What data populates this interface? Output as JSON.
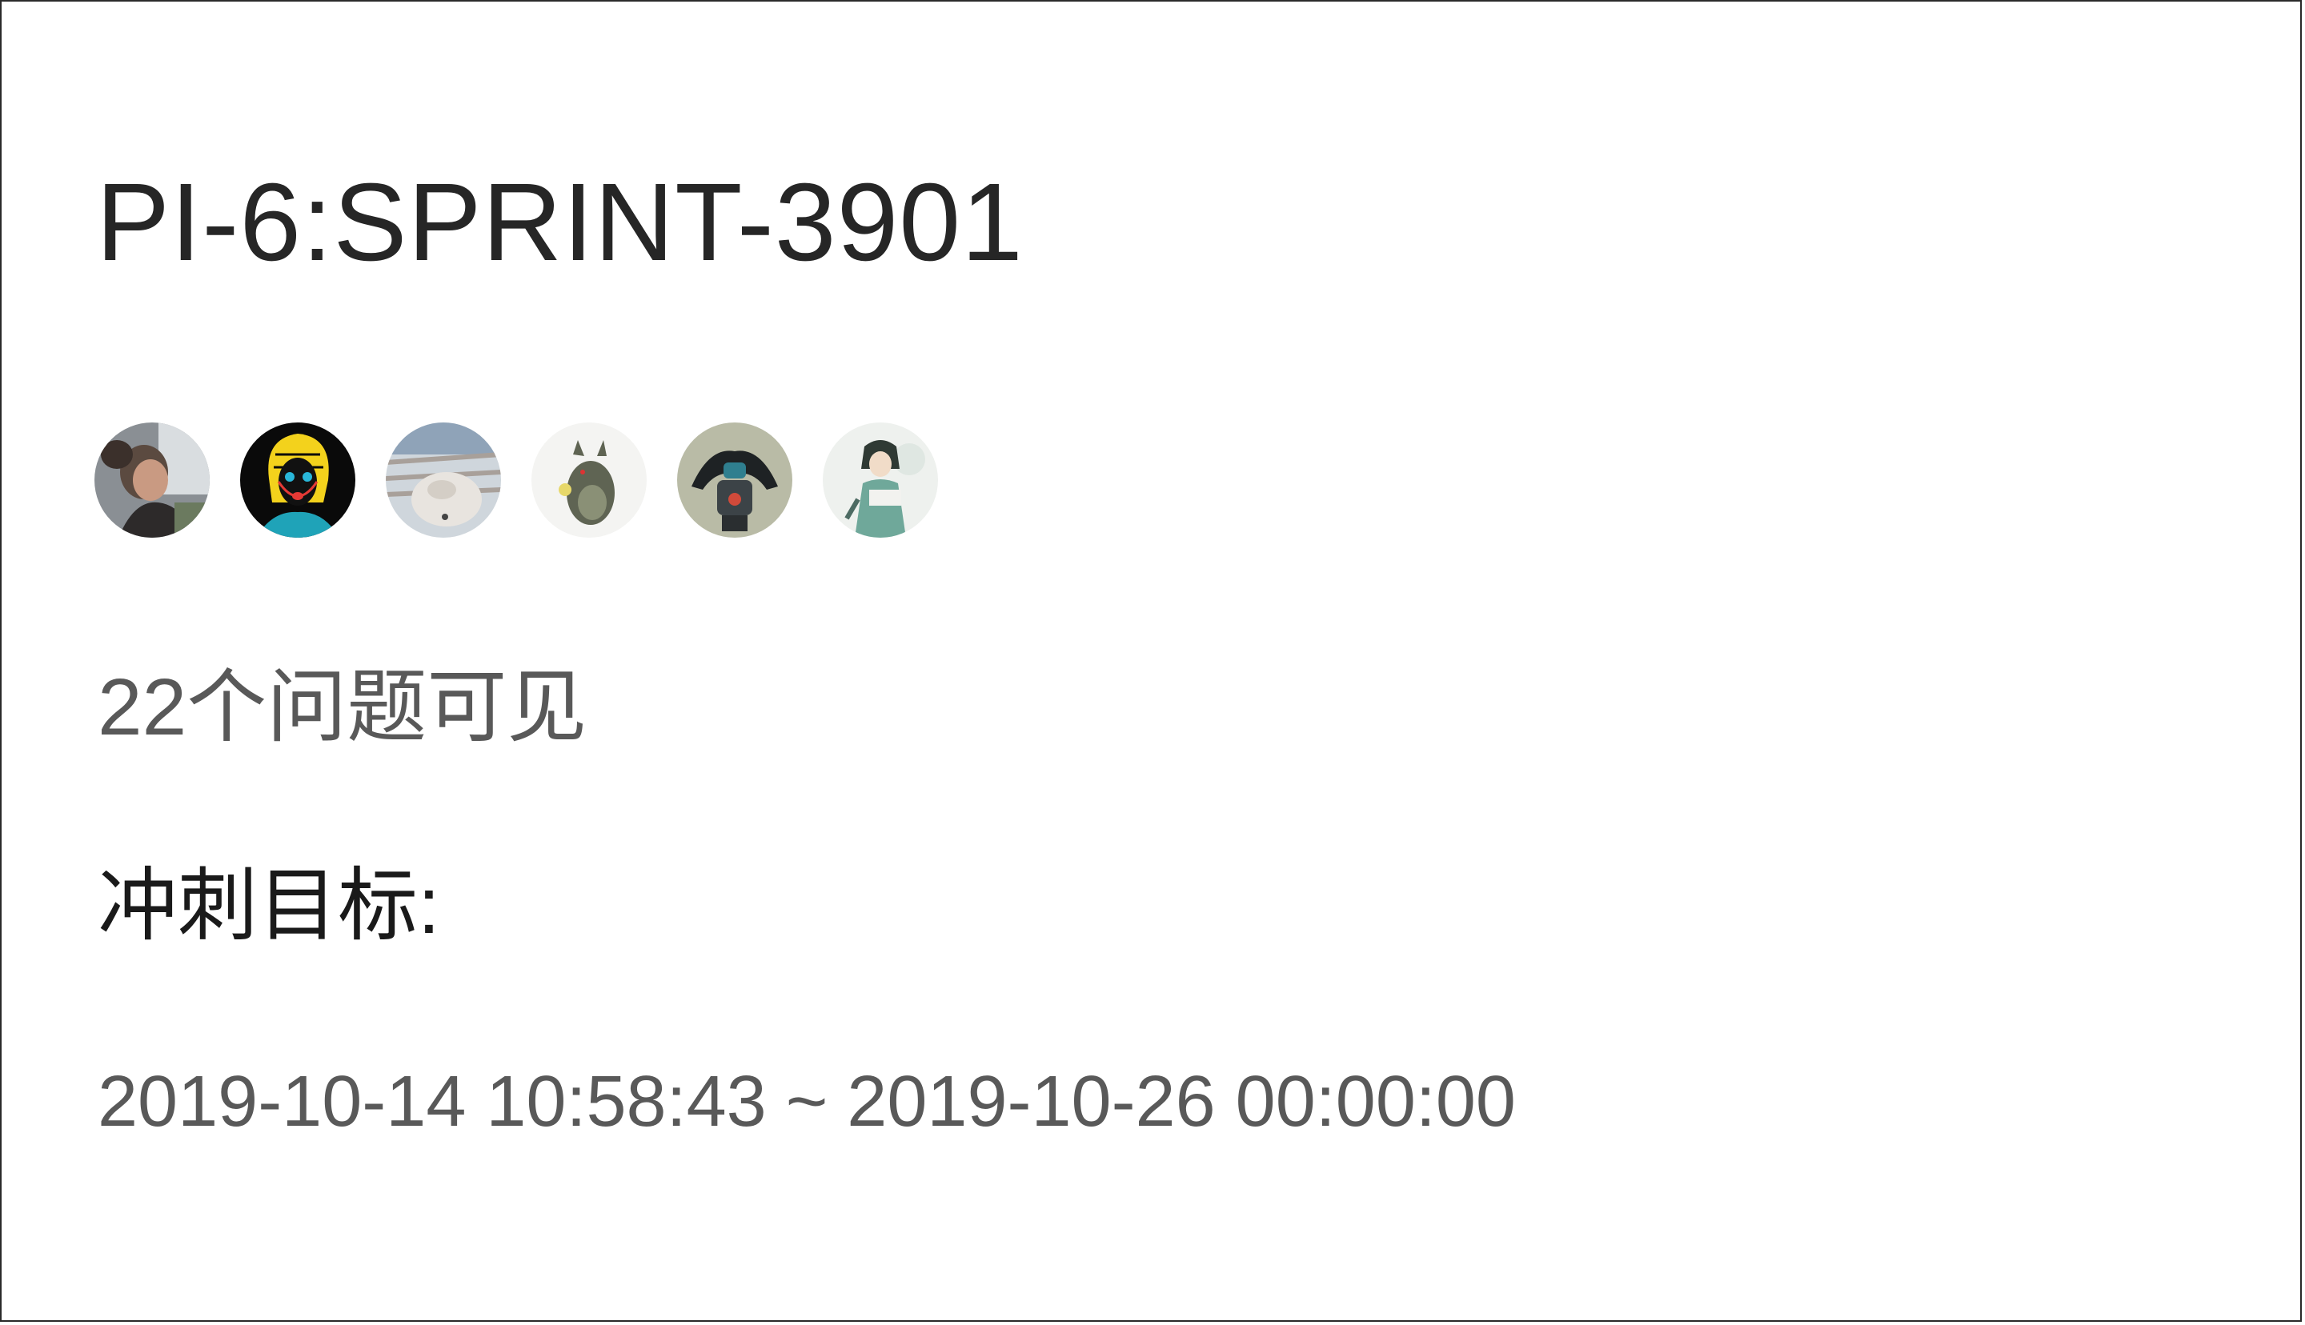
{
  "sprint": {
    "title": "PI-6:SPRINT-3901",
    "issue_count_text": "22个问题可见",
    "goal_label": "冲刺目标:",
    "date_start": "2019-10-14 10:58:43",
    "date_separator": "~",
    "date_end": "2019-10-26 00:00:00"
  },
  "members": [
    {
      "avatar": "user-photo-1"
    },
    {
      "avatar": "user-illustration-2"
    },
    {
      "avatar": "user-photo-3"
    },
    {
      "avatar": "user-illustration-4"
    },
    {
      "avatar": "user-illustration-5"
    },
    {
      "avatar": "user-illustration-6"
    }
  ],
  "colors": {
    "title": "#262626",
    "secondary_text": "#595959",
    "border": "#2a2a2a"
  }
}
